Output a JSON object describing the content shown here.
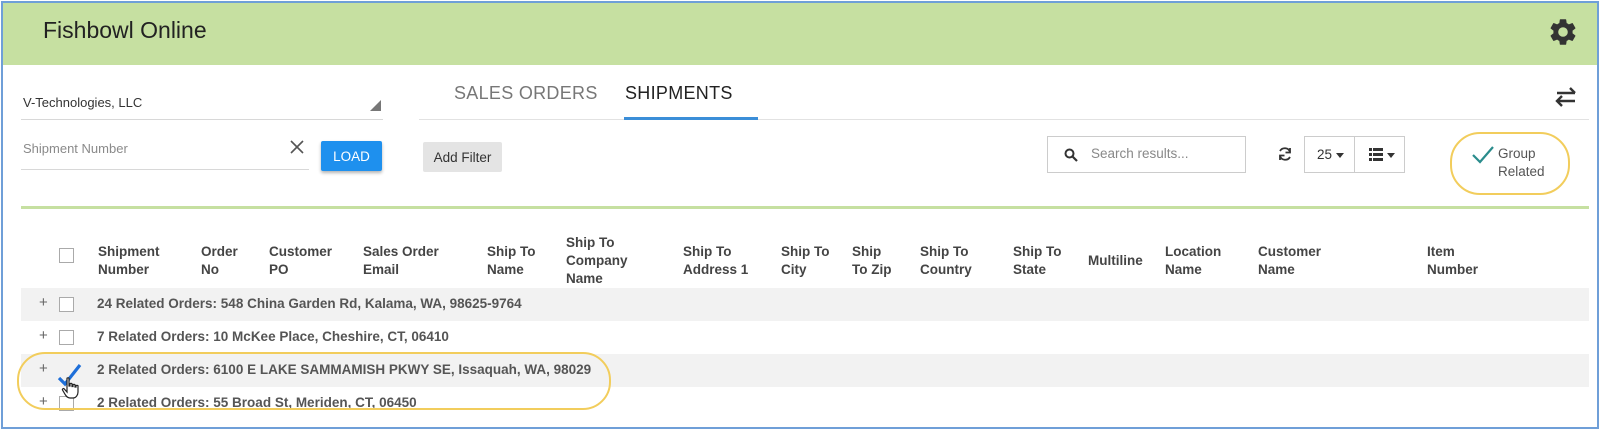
{
  "app": {
    "title": "Fishbowl Online"
  },
  "sidebar": {
    "company": "V-Technologies, LLC",
    "shipment_placeholder": "Shipment Number",
    "load_label": "LOAD"
  },
  "tabs": [
    {
      "label": "SALES ORDERS",
      "active": false
    },
    {
      "label": "SHIPMENTS",
      "active": true
    }
  ],
  "toolbar": {
    "add_filter": "Add Filter",
    "search_placeholder": "Search results...",
    "page_size": "25",
    "group_related_line1": "Group",
    "group_related_line2": "Related"
  },
  "columns": [
    "Shipment Number",
    "Order No",
    "Customer PO",
    "Sales Order Email",
    "Ship To Name",
    "Ship To Company Name",
    "Ship To Address 1",
    "Ship To City",
    "Ship To Zip",
    "Ship To Country",
    "Ship To State",
    "Multiline",
    "Location Name",
    "Customer Name",
    "Item Number"
  ],
  "groups": [
    {
      "label": "24 Related Orders: 548 China Garden Rd, Kalama, WA, 98625-9764",
      "checked": false
    },
    {
      "label": "7 Related Orders: 10 McKee Place, Cheshire, CT, 06410",
      "checked": false
    },
    {
      "label": "2 Related Orders: 6100 E LAKE SAMMAMISH PKWY SE, Issaquah, WA, 98029",
      "checked": true
    },
    {
      "label": "2 Related Orders: 55 Broad St, Meriden, CT, 06450",
      "checked": false
    }
  ],
  "colors": {
    "header_bg": "#c6e0a1",
    "accent_blue": "#1e90ee",
    "highlight": "#f2cd5c",
    "check_color": "#2a8c8c"
  },
  "icons": [
    "gear-icon",
    "close-icon",
    "swap-icon",
    "search-icon",
    "refresh-icon",
    "list-icon",
    "check-icon",
    "hand-cursor-icon"
  ]
}
